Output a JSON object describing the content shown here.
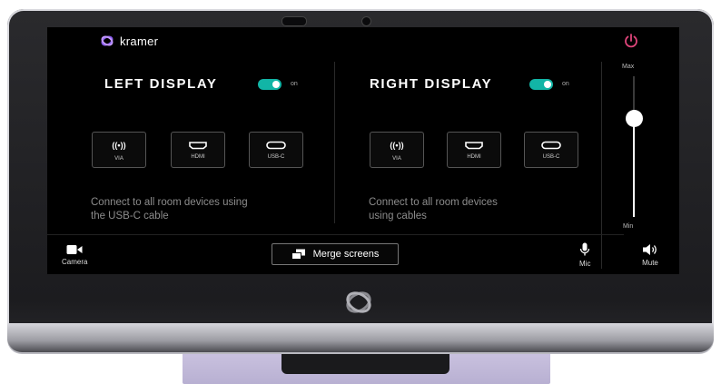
{
  "brand": {
    "name": "kramer",
    "accent": "#8a5cf0"
  },
  "power": {
    "icon": "power-icon",
    "color": "#e0457b"
  },
  "left": {
    "title": "LEFT DISPLAY",
    "toggle_label": "on",
    "sources": [
      {
        "icon": "wireless-icon",
        "label": "VIA"
      },
      {
        "icon": "hdmi-icon",
        "label": "HDMI"
      },
      {
        "icon": "usb-c-icon",
        "label": "USB-C"
      }
    ],
    "hint_line1": "Connect to all room devices using",
    "hint_line2": "the USB-C cable"
  },
  "right": {
    "title": "RIGHT DISPLAY",
    "toggle_label": "on",
    "sources": [
      {
        "icon": "wireless-icon",
        "label": "VIA"
      },
      {
        "icon": "hdmi-icon",
        "label": "HDMI"
      },
      {
        "icon": "usb-c-icon",
        "label": "USB-C"
      }
    ],
    "hint_line1": "Connect to all room devices",
    "hint_line2": "using cables"
  },
  "bottom": {
    "camera_label": "Camera",
    "merge_label": "Merge screens",
    "mic_label": "Mic",
    "mute_label": "Mute"
  },
  "volume": {
    "max_label": "Max",
    "min_label": "Min",
    "level": 0.7
  },
  "toggle_color": "#12b5a6"
}
